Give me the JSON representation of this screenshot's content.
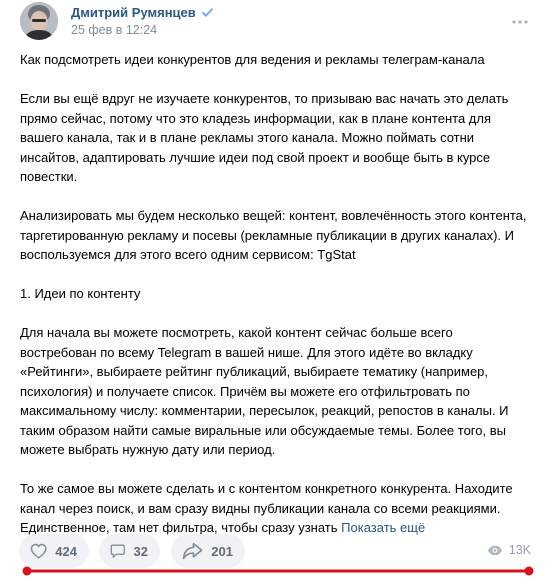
{
  "post": {
    "author": "Дмитрий Румянцев",
    "date": "25 фев в 12:24",
    "paragraphs": [
      "Как подсмотреть идеи конкурентов для ведения и рекламы телеграм-канала",
      "Если вы ещё вдруг не изучаете конкурентов, то призываю вас начать это делать прямо сейчас, потому что это кладезь информации, как в плане контента для вашего канала, так и в плане рекламы этого канала. Можно поймать сотни инсайтов, адаптировать лучшие идеи под свой проект и вообще быть в курсе повестки.",
      "Анализировать мы будем несколько вещей: контент, вовлечённость этого контента, таргетированную рекламу и посевы (рекламные публикации в других каналах). И воспользуемся для этого всего одним сервисом: TgStat",
      "1. Идеи по контенту",
      "Для начала вы можете посмотреть, какой контент сейчас больше всего востребован по всему Telegram в вашей нише. Для этого идёте во вкладку «Рейтинги», выбираете рейтинг публикаций, выбираете тематику (например, психология) и получаете список. Причём вы можете его отфильтровать по максимальному числу: комментарии, пересылок, реакций, репостов в каналы. И таким образом найти самые виральные или обсуждаемые темы. Более того, вы можете выбрать нужную дату или период."
    ],
    "last_paragraph": "То же самое вы можете сделать и с контентом конкретного конкурента. Находите канал через поиск, и вам сразу видны публикации канала со всеми реакциями. Единственное, там нет фильтра, чтобы сразу узнать",
    "show_more": "Показать ещё"
  },
  "actions": {
    "likes": "424",
    "comments": "32",
    "shares": "201",
    "views": "13K"
  },
  "colors": {
    "link": "#2a5885",
    "annotation_red": "#d8121c",
    "pill_bg": "#f0f2f5"
  },
  "icons": [
    "verified-icon",
    "more-icon",
    "like-icon",
    "comment-icon",
    "share-icon",
    "views-icon"
  ]
}
